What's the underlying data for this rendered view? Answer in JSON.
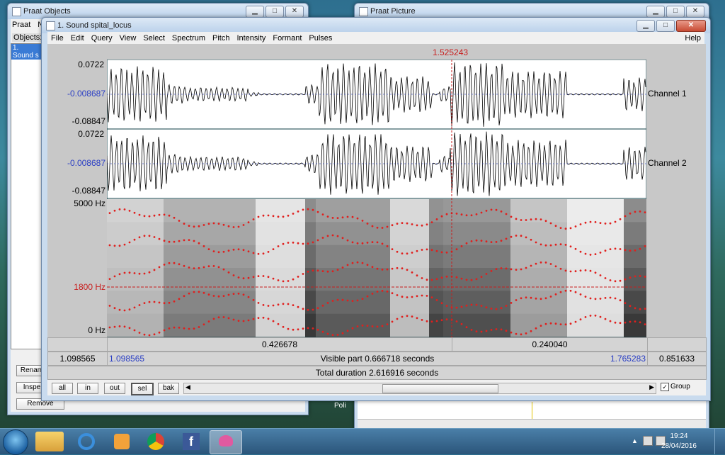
{
  "objects_window": {
    "title": "Praat Objects",
    "menu": [
      "Praat",
      "N"
    ],
    "objects_label": "Objects:",
    "selected_item": "1. Sound s",
    "buttons": [
      "Renam",
      "Inspe",
      "Remove"
    ]
  },
  "picture_window": {
    "title": "Praat Picture"
  },
  "sound_window": {
    "title": "1. Sound spital_locus",
    "menu": [
      "File",
      "Edit",
      "Query",
      "View",
      "Select",
      "Spectrum",
      "Pitch",
      "Intensity",
      "Formant",
      "Pulses"
    ],
    "help": "Help",
    "cursor_time": "1.525243",
    "channel1": {
      "max": "0.0722",
      "mid": "-0.008687",
      "min": "-0.08847",
      "name": "Channel 1"
    },
    "channel2": {
      "max": "0.0722",
      "mid": "-0.008687",
      "min": "-0.08847",
      "name": "Channel 2"
    },
    "spectrogram": {
      "top": "5000 Hz",
      "cursor_freq": "1800 Hz",
      "bottom": "0 Hz"
    },
    "durations": {
      "left": "0.426678",
      "right": "0.240040"
    },
    "visible_bar": {
      "outer_left": "1.098565",
      "left": "1.098565",
      "label": "Visible part 0.666718 seconds",
      "right": "1.765283",
      "outer_right": "0.851633"
    },
    "total_bar": "Total duration 2.616916 seconds",
    "buttons": [
      "all",
      "in",
      "out",
      "sel",
      "bak"
    ],
    "group_label": "Group",
    "group_checked": true
  },
  "taskbar": {
    "time": "19:24",
    "date": "28/04/2016",
    "partial_label": "Poli"
  },
  "colors": {
    "selection_blue": "#2b3fc4",
    "cursor_red": "#c81e1e",
    "formant_red": "#e0201e"
  }
}
